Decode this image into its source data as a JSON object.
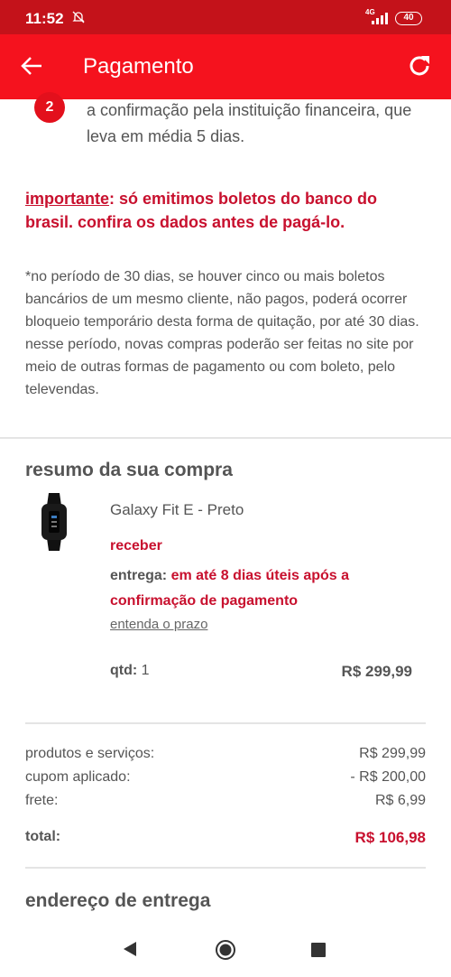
{
  "status_bar": {
    "time": "11:52",
    "network": "4G",
    "battery": "40"
  },
  "app_bar": {
    "title": "Pagamento",
    "back_icon": "arrow-left-icon",
    "refresh_icon": "refresh-icon"
  },
  "step": {
    "number": "2",
    "text": "a confirmação pela instituição financeira, que leva em média 5 dias."
  },
  "important": {
    "keyword": "importante",
    "text": ": só emitimos boletos do banco do brasil. confira os dados antes de pagá-lo."
  },
  "note": "*no período de 30 dias, se houver cinco ou mais boletos bancários de um mesmo cliente, não pagos, poderá ocorrer bloqueio temporário desta forma de quitação, por até 30 dias. nesse período, novas compras poderão ser feitas no site por meio de outras formas de pagamento ou com boleto, pelo televendas.",
  "summary": {
    "title": "resumo da sua compra",
    "product": {
      "name": "Galaxy Fit E - Preto",
      "receive_label": "receber",
      "delivery_label": "entrega:",
      "delivery_text": "em até 8 dias úteis após a confirmação de pagamento",
      "deadline_link": "entenda o prazo",
      "qty_label": "qtd:",
      "qty_value": "1",
      "price": "R$ 299,99"
    },
    "totals": [
      {
        "label": "produtos e serviços:",
        "value": "R$ 299,99"
      },
      {
        "label": "cupom aplicado:",
        "value": "- R$ 200,00"
      },
      {
        "label": "frete:",
        "value": "R$ 6,99"
      }
    ],
    "total_label": "total:",
    "total_value": "R$ 106,98"
  },
  "address_title": "endereço de entrega",
  "colors": {
    "status_bar": "#c4121a",
    "app_bar": "#f5121e",
    "accent": "#c8102e"
  }
}
